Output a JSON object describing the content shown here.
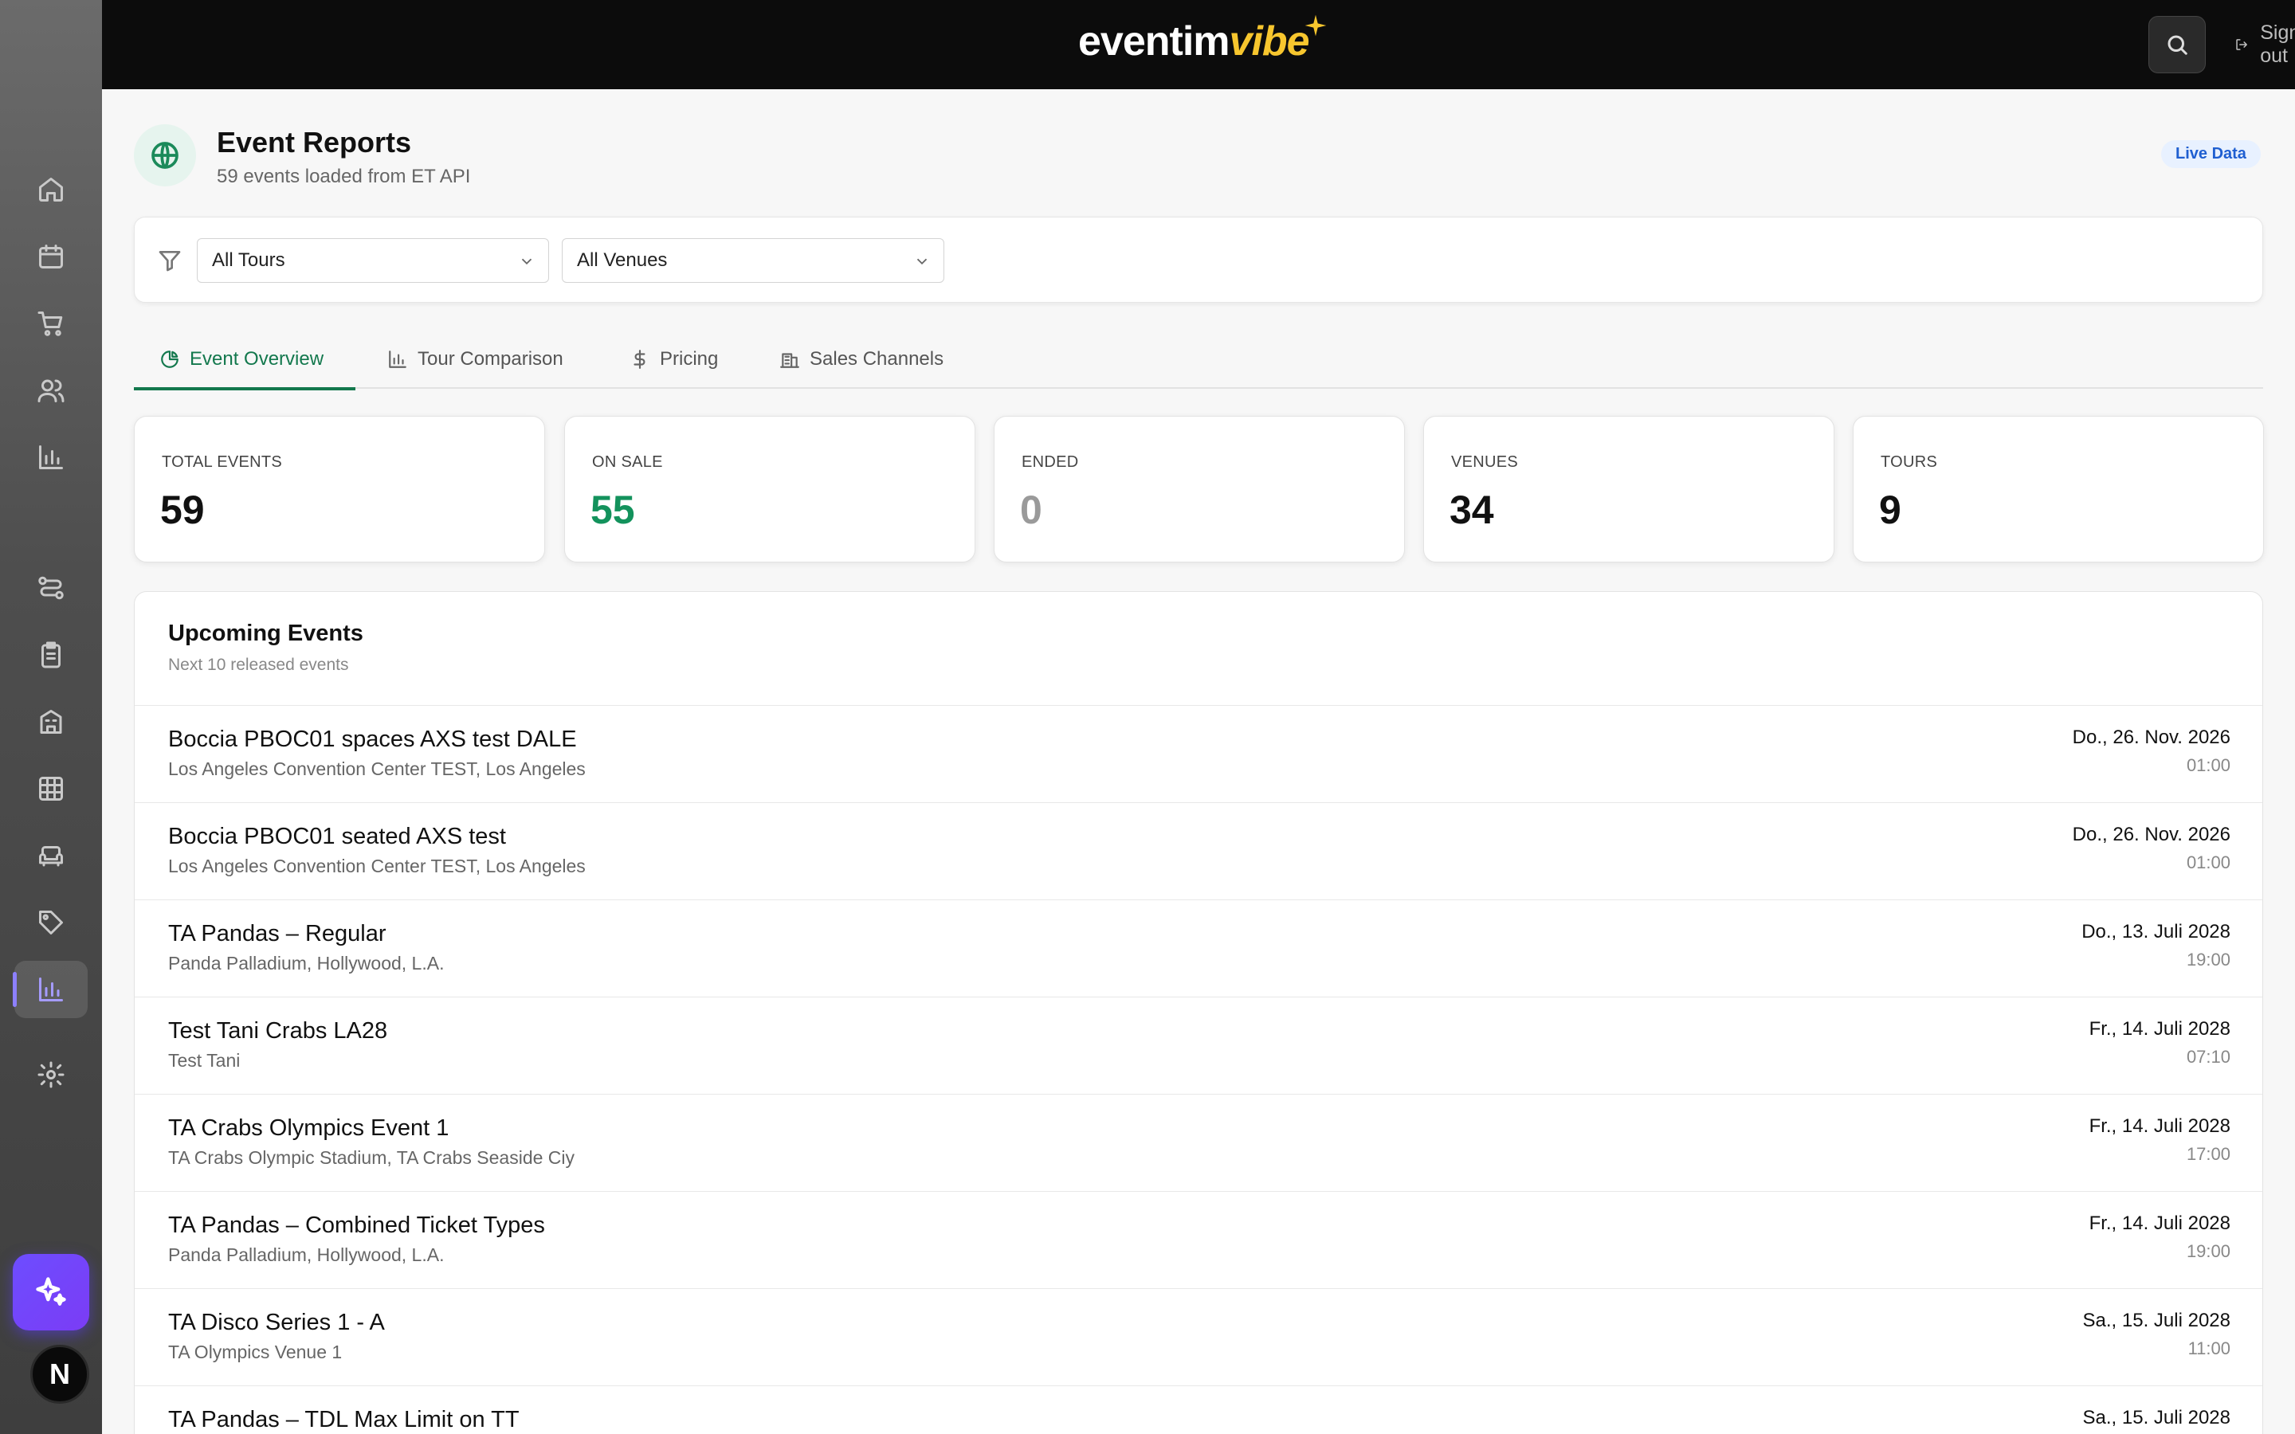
{
  "brand": {
    "word_white": "eventim",
    "word_yellow": "vibe"
  },
  "topbar": {
    "signout_label": "Sign out"
  },
  "sidebar": {
    "items": [
      {
        "icon": "home-icon"
      },
      {
        "icon": "calendar-icon"
      },
      {
        "icon": "cart-icon"
      },
      {
        "icon": "users-icon"
      },
      {
        "icon": "chart-icon"
      },
      {
        "icon": "route-icon"
      },
      {
        "icon": "clipboard-icon"
      },
      {
        "icon": "building-icon"
      },
      {
        "icon": "grid-icon"
      },
      {
        "icon": "sofa-icon"
      },
      {
        "icon": "tag-icon"
      },
      {
        "icon": "reports-icon"
      },
      {
        "icon": "gear-icon"
      }
    ],
    "active": "reports-icon",
    "avatar_initial": "N"
  },
  "header": {
    "title": "Event Reports",
    "subtitle": "59 events loaded from ET API",
    "badge": "Live Data"
  },
  "filters": {
    "tours": "All Tours",
    "venues": "All Venues"
  },
  "tabs": [
    {
      "label": "Event Overview",
      "icon": "pie-icon",
      "active": true
    },
    {
      "label": "Tour Comparison",
      "icon": "bar-chart-icon",
      "active": false
    },
    {
      "label": "Pricing",
      "icon": "dollar-icon",
      "active": false
    },
    {
      "label": "Sales Channels",
      "icon": "building-icon",
      "active": false
    }
  ],
  "stats": [
    {
      "label": "TOTAL EVENTS",
      "value": "59",
      "color": "#111111"
    },
    {
      "label": "ON SALE",
      "value": "55",
      "color": "#13925c"
    },
    {
      "label": "ENDED",
      "value": "0",
      "color": "#9a9a9a"
    },
    {
      "label": "VENUES",
      "value": "34",
      "color": "#111111"
    },
    {
      "label": "TOURS",
      "value": "9",
      "color": "#111111"
    }
  ],
  "events": {
    "title": "Upcoming Events",
    "subtitle": "Next 10 released events",
    "rows": [
      {
        "name": "Boccia PBOC01 spaces AXS test DALE",
        "venue": "Los Angeles Convention Center TEST, Los Angeles",
        "date": "Do., 26. Nov. 2026",
        "time": "01:00"
      },
      {
        "name": "Boccia PBOC01 seated AXS test",
        "venue": "Los Angeles Convention Center TEST, Los Angeles",
        "date": "Do., 26. Nov. 2026",
        "time": "01:00"
      },
      {
        "name": "TA Pandas – Regular",
        "venue": "Panda Palladium, Hollywood, L.A.",
        "date": "Do., 13. Juli 2028",
        "time": "19:00"
      },
      {
        "name": "Test Tani Crabs LA28",
        "venue": "Test Tani",
        "date": "Fr., 14. Juli 2028",
        "time": "07:10"
      },
      {
        "name": "TA Crabs Olympics Event 1",
        "venue": "TA Crabs Olympic Stadium, TA Crabs Seaside Ciy",
        "date": "Fr., 14. Juli 2028",
        "time": "17:00"
      },
      {
        "name": "TA Pandas – Combined Ticket Types",
        "venue": "Panda Palladium, Hollywood, L.A.",
        "date": "Fr., 14. Juli 2028",
        "time": "19:00"
      },
      {
        "name": "TA Disco Series 1 - A",
        "venue": "TA Olympics Venue 1",
        "date": "Sa., 15. Juli 2028",
        "time": "11:00"
      },
      {
        "name": "TA Pandas – TDL Max Limit on TT",
        "venue": "",
        "date": "Sa., 15. Juli 2028",
        "time": ""
      }
    ]
  }
}
